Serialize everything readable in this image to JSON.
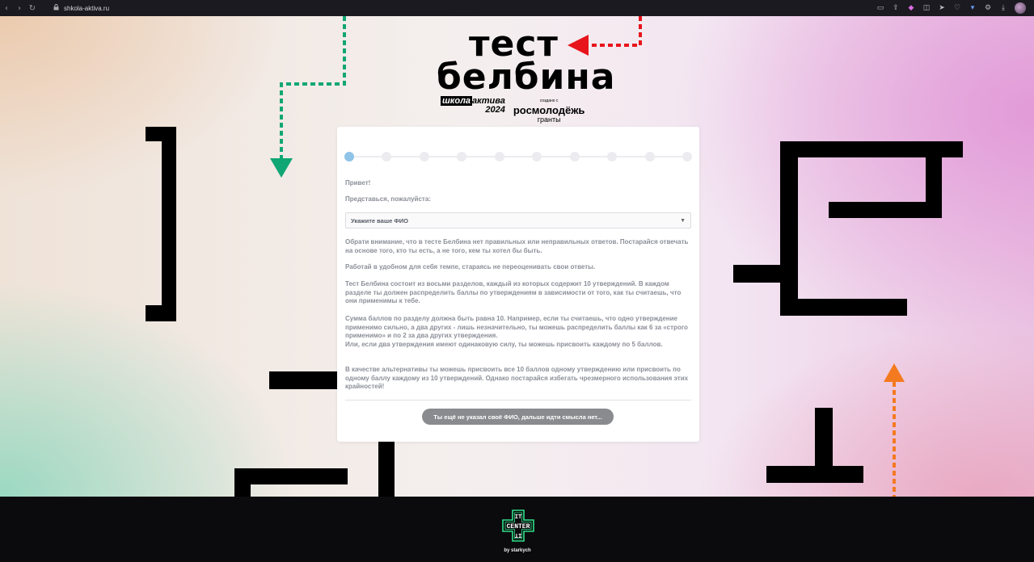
{
  "browser": {
    "url": "shkola-aktiva.ru",
    "nav": {
      "back": "‹",
      "forward": "›",
      "reload": "↻"
    },
    "toolbar_icons": [
      "bookmark-icon",
      "share-icon",
      "shield-icon",
      "extension-icon",
      "send-icon",
      "heart-icon",
      "cart-icon",
      "settings-icon",
      "download-icon"
    ]
  },
  "logo": {
    "line1": "тест",
    "line2": "белбина",
    "partner1": {
      "word1": "школа",
      "word2": "актива",
      "year": "2024"
    },
    "partner2": {
      "created": "создано с",
      "name": "росмолодёжь",
      "sub": "гранты"
    }
  },
  "form": {
    "steps_total": 10,
    "active_step": 1,
    "greeting": "Привет!",
    "intro": "Представься, пожалуйста:",
    "select_placeholder": "Укажите ваше ФИО",
    "p1": "Обрати внимание, что в тесте Белбина нет правильных или неправильных ответов. Постарайся отвечать на основе того, кто ты есть, а не того, кем ты хотел бы быть.",
    "p2": "Работай в удобном для себя темпе, стараясь не переоценивать свои ответы.",
    "p3": "Тест Белбина состоит из восьми разделов, каждый из которых содержит 10 утверждений. В каждом разделе ты должен распределить баллы по утверждениям в зависимости от того, как ты считаешь, что они применимы к тебе.",
    "p4a": "Сумма баллов по разделу должна быть равна 10. Например, если ты считаешь, что одно утверждение применимо сильно, а два других - лишь незначительно, ты можешь распределить баллы как 6 за «строго применимо» и по 2 за два других утверждения.",
    "p4b": "Или, если два утверждения имеют одинаковую силу, ты можешь присвоить каждому по 5 баллов.",
    "p5": "В качестве альтернативы ты можешь присвоить все 10 баллов одному утверждению или присвоить по одному баллу каждому из 10 утверждений. Однако постарайся избегать чрезмерного использования этих крайностей!",
    "button": "Ты ещё не указал своё ФИО, дальше идти смысла нет..."
  },
  "footer": {
    "logo_top": "IT",
    "logo_mid": "CENTER",
    "logo_bottom": "IT",
    "byline": "by starkych"
  },
  "colors": {
    "green_arrow": "#10a774",
    "red_arrow": "#e8141c",
    "orange_arrow": "#f47a20",
    "step_active": "#8fc3e8",
    "footer_accent": "#2fe08a"
  }
}
